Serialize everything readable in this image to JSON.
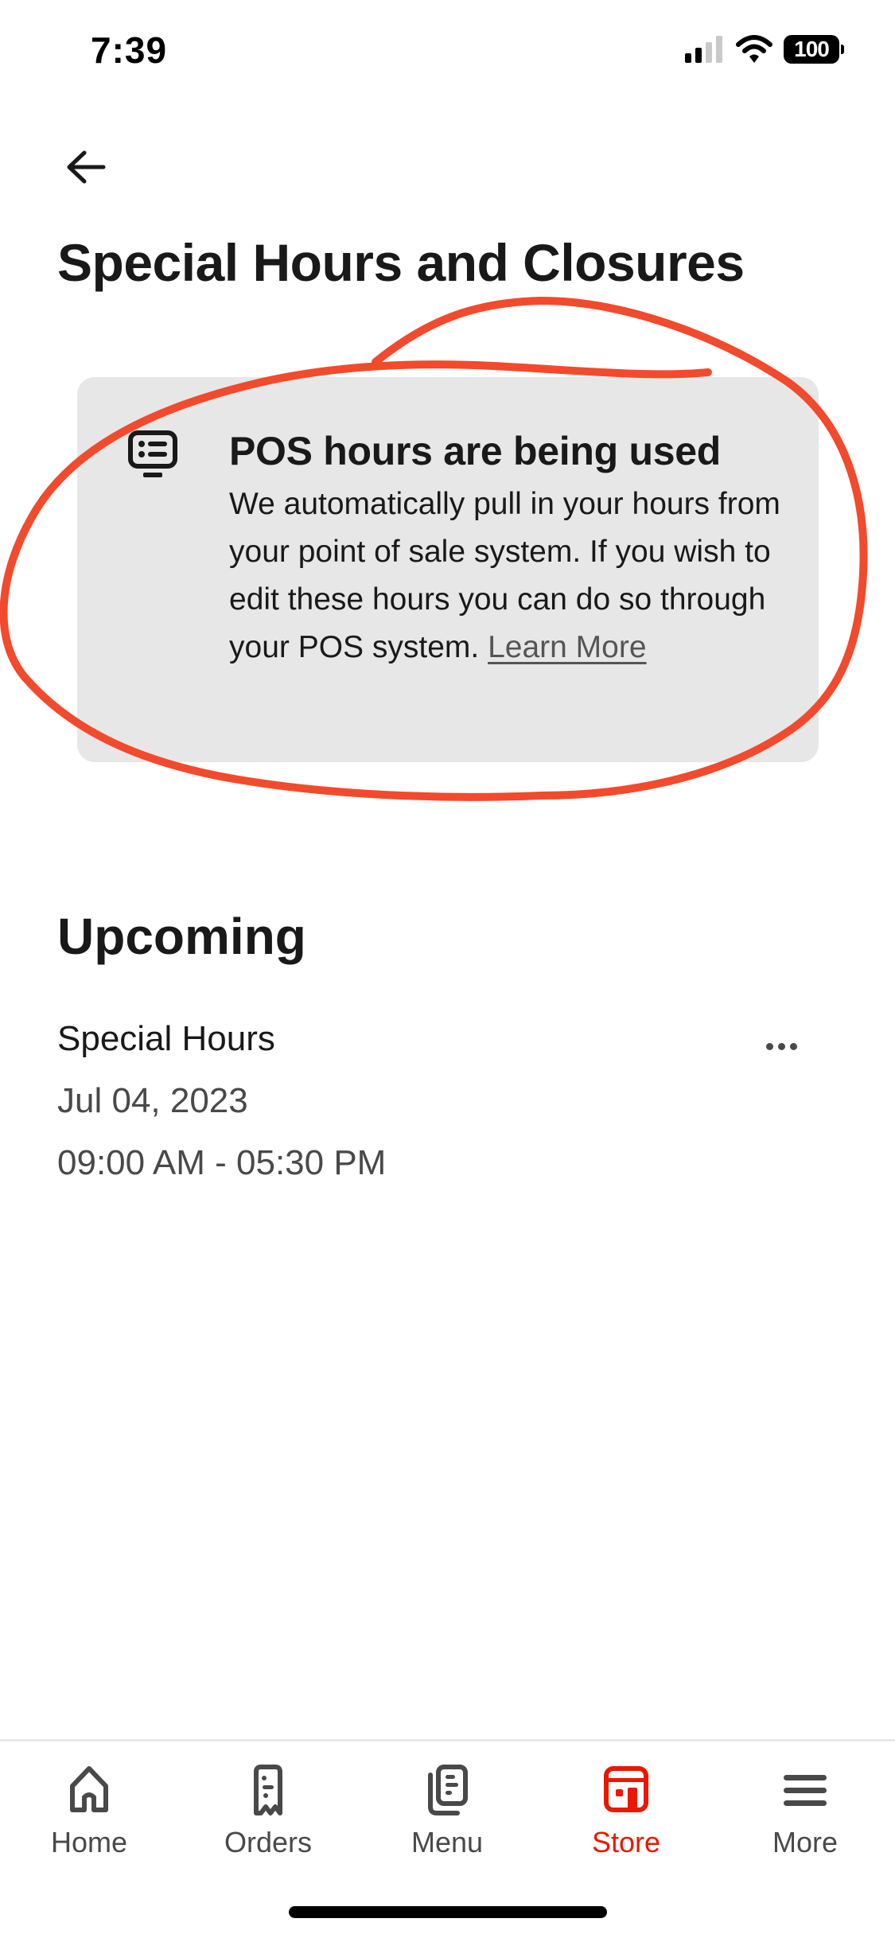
{
  "status_bar": {
    "time": "7:39",
    "battery": "100",
    "signal_icon": "cellular-signal-icon",
    "wifi_icon": "wifi-icon"
  },
  "header": {
    "back_icon": "arrow-left-icon",
    "title": "Special Hours and Closures"
  },
  "info_card": {
    "icon": "pos-terminal-icon",
    "title": "POS hours are being used",
    "body": "We automatically pull in your hours from your point of sale system. If you wish to edit these hours you can do so through your POS system. ",
    "link_label": "Learn More"
  },
  "upcoming": {
    "section_title": "Upcoming",
    "items": [
      {
        "label": "Special Hours",
        "date": "Jul 04, 2023",
        "time_range": "09:00 AM - 05:30 PM",
        "menu_icon": "more-horizontal-icon"
      }
    ]
  },
  "tab_bar": {
    "active_color": "#eb1700",
    "inactive_color": "#494949",
    "tabs": [
      {
        "label": "Home",
        "icon": "home-icon",
        "active": false
      },
      {
        "label": "Orders",
        "icon": "receipt-icon",
        "active": false
      },
      {
        "label": "Menu",
        "icon": "menu-book-icon",
        "active": false
      },
      {
        "label": "Store",
        "icon": "store-icon",
        "active": true
      },
      {
        "label": "More",
        "icon": "hamburger-icon",
        "active": false
      }
    ]
  },
  "annotation": {
    "color": "#f24a2c"
  }
}
